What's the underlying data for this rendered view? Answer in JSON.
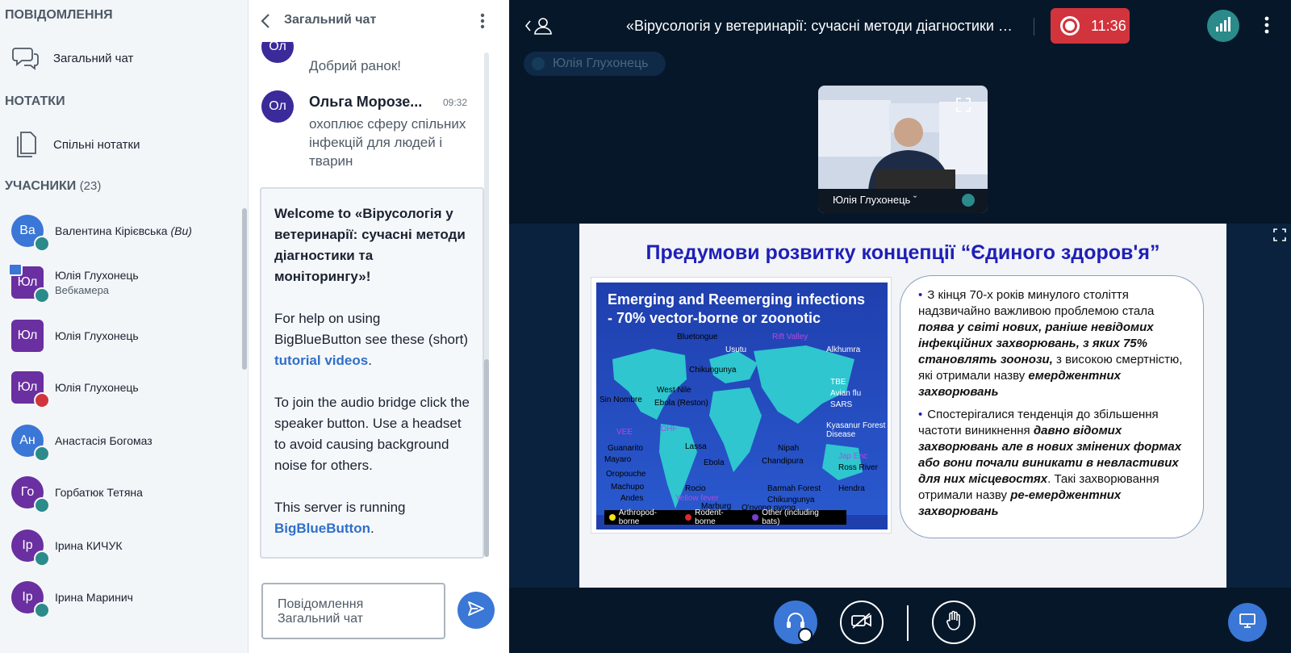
{
  "userlist": {
    "messages_title": "ПОВІДОМЛЕННЯ",
    "public_chat_label": "Загальний чат",
    "notes_title": "НОТАТКИ",
    "shared_notes_label": "Спільні нотатки",
    "participants_title": "УЧАСНИКИ",
    "participants_count": "(23)",
    "users": [
      {
        "initials": "Ва",
        "name": "Валентина Кірієвська",
        "suffix": "(Ви)",
        "color": "#3a77d6",
        "badge": "headset",
        "shape": "round"
      },
      {
        "initials": "Юл",
        "name": "Юлія Глухонець",
        "sub": "Вебкамера",
        "color": "#6a2fa0",
        "badge": "mic",
        "shape": "square",
        "presenter": true
      },
      {
        "initials": "Юл",
        "name": "Юлія Глухонець",
        "color": "#6a2fa0",
        "badge": "none",
        "shape": "square"
      },
      {
        "initials": "Юл",
        "name": "Юлія Глухонець",
        "color": "#6a2fa0",
        "badge": "muted",
        "shape": "square"
      },
      {
        "initials": "Ан",
        "name": "Анастасія Богомаз",
        "color": "#3a77d6",
        "badge": "headset",
        "shape": "round"
      },
      {
        "initials": "Го",
        "name": "Горбатюк Тетяна",
        "color": "#6a2fa0",
        "badge": "headset",
        "shape": "round"
      },
      {
        "initials": "Ір",
        "name": "Ірина КИЧУК",
        "color": "#6a2fa0",
        "badge": "headset",
        "shape": "round"
      },
      {
        "initials": "Ір",
        "name": "Ірина Маринич",
        "color": "#6a2fa0",
        "badge": "headset",
        "shape": "round"
      }
    ]
  },
  "chat": {
    "title": "Загальний чат",
    "messages": [
      {
        "initials": "Ол",
        "text": "Добрий ранок!",
        "color": "#3a2a9a"
      },
      {
        "initials": "Ол",
        "author": "Ольга Морозе...",
        "time": "09:32",
        "text": "охоплює сферу спільних інфекцій для людей і тварин",
        "color": "#3a2a9a"
      }
    ],
    "welcome": {
      "prefix": "Welcome to ",
      "meeting": "«Вірусологія у ветеринарії: сучасні методи діагностики та моніторингу»",
      "suffix": "!",
      "help_before": "For help on using BigBlueButton see these (short) ",
      "help_link": "tutorial videos",
      "help_after": ".",
      "audio": "To join the audio bridge click the speaker button. Use a headset to avoid causing background noise for others.",
      "server_before": "This server is running ",
      "server_link": "BigBlueButton",
      "server_after": "."
    },
    "input_placeholder": "Повідомлення Загальний чат"
  },
  "main": {
    "title": "«Вірусологія у ветеринарії: сучасні методи діагностики та...",
    "recording_time": "11:36",
    "talking": "Юлія Глухонець",
    "webcam_name": "Юлія Глухонець ˇ"
  },
  "slide": {
    "title": "Предумови розвитку концепції “Єдиного здоров'я”",
    "map_title": "Emerging and Reemerging infections - 70% vector-borne or zoonotic",
    "map_labels": [
      "Bluetongue",
      "Rift Valley",
      "Usutu",
      "Alkhumra",
      "Chikungunya",
      "West Nile",
      "Sin Nombre",
      "Ebola (Reston)",
      "TBE",
      "Avian flu",
      "SARS",
      "Kyasanur Forest Disease",
      "VEE",
      "DHF",
      "Guanarito",
      "Mayaro",
      "Lassa",
      "Ebola",
      "Nipah",
      "Chandipura",
      "Oropouche",
      "Machupo",
      "Rocio",
      "Barmah Forest",
      "Chikungunya",
      "Hendra",
      "Ross River",
      "Andes",
      "Yellow fever",
      "Marburg",
      "O'nyong nyong",
      "Jap Enc"
    ],
    "legend": [
      "Arthropod-borne",
      "Rodent-borne",
      "Other (including bats)"
    ],
    "bullet1_a": "З кінця 70-х років минулого століття надзвичайно важливою проблемою стала ",
    "bullet1_b": "поява у світі нових, раніше невідомих інфекційних захворювань, з яких  75% становлять зоонози,",
    "bullet1_c": " з високою смертністю, які отримали назву ",
    "bullet1_d": "емерджентних захворювань",
    "bullet2_a": "Спостерігалися тенденція до збільшення частоти виникнення ",
    "bullet2_b": "давно відомих захворювань але в нових змінених формах або вони почали виникати в невластивих для них місцевостях",
    "bullet2_c": ". Такі захворювання отримали назву ",
    "bullet2_d": "ре-емерджентних захворювань"
  },
  "colors": {
    "accent": "#3a77d6",
    "recording": "#d1343c",
    "main_bg": "#06172a",
    "slide_title": "#1f1fb8"
  }
}
